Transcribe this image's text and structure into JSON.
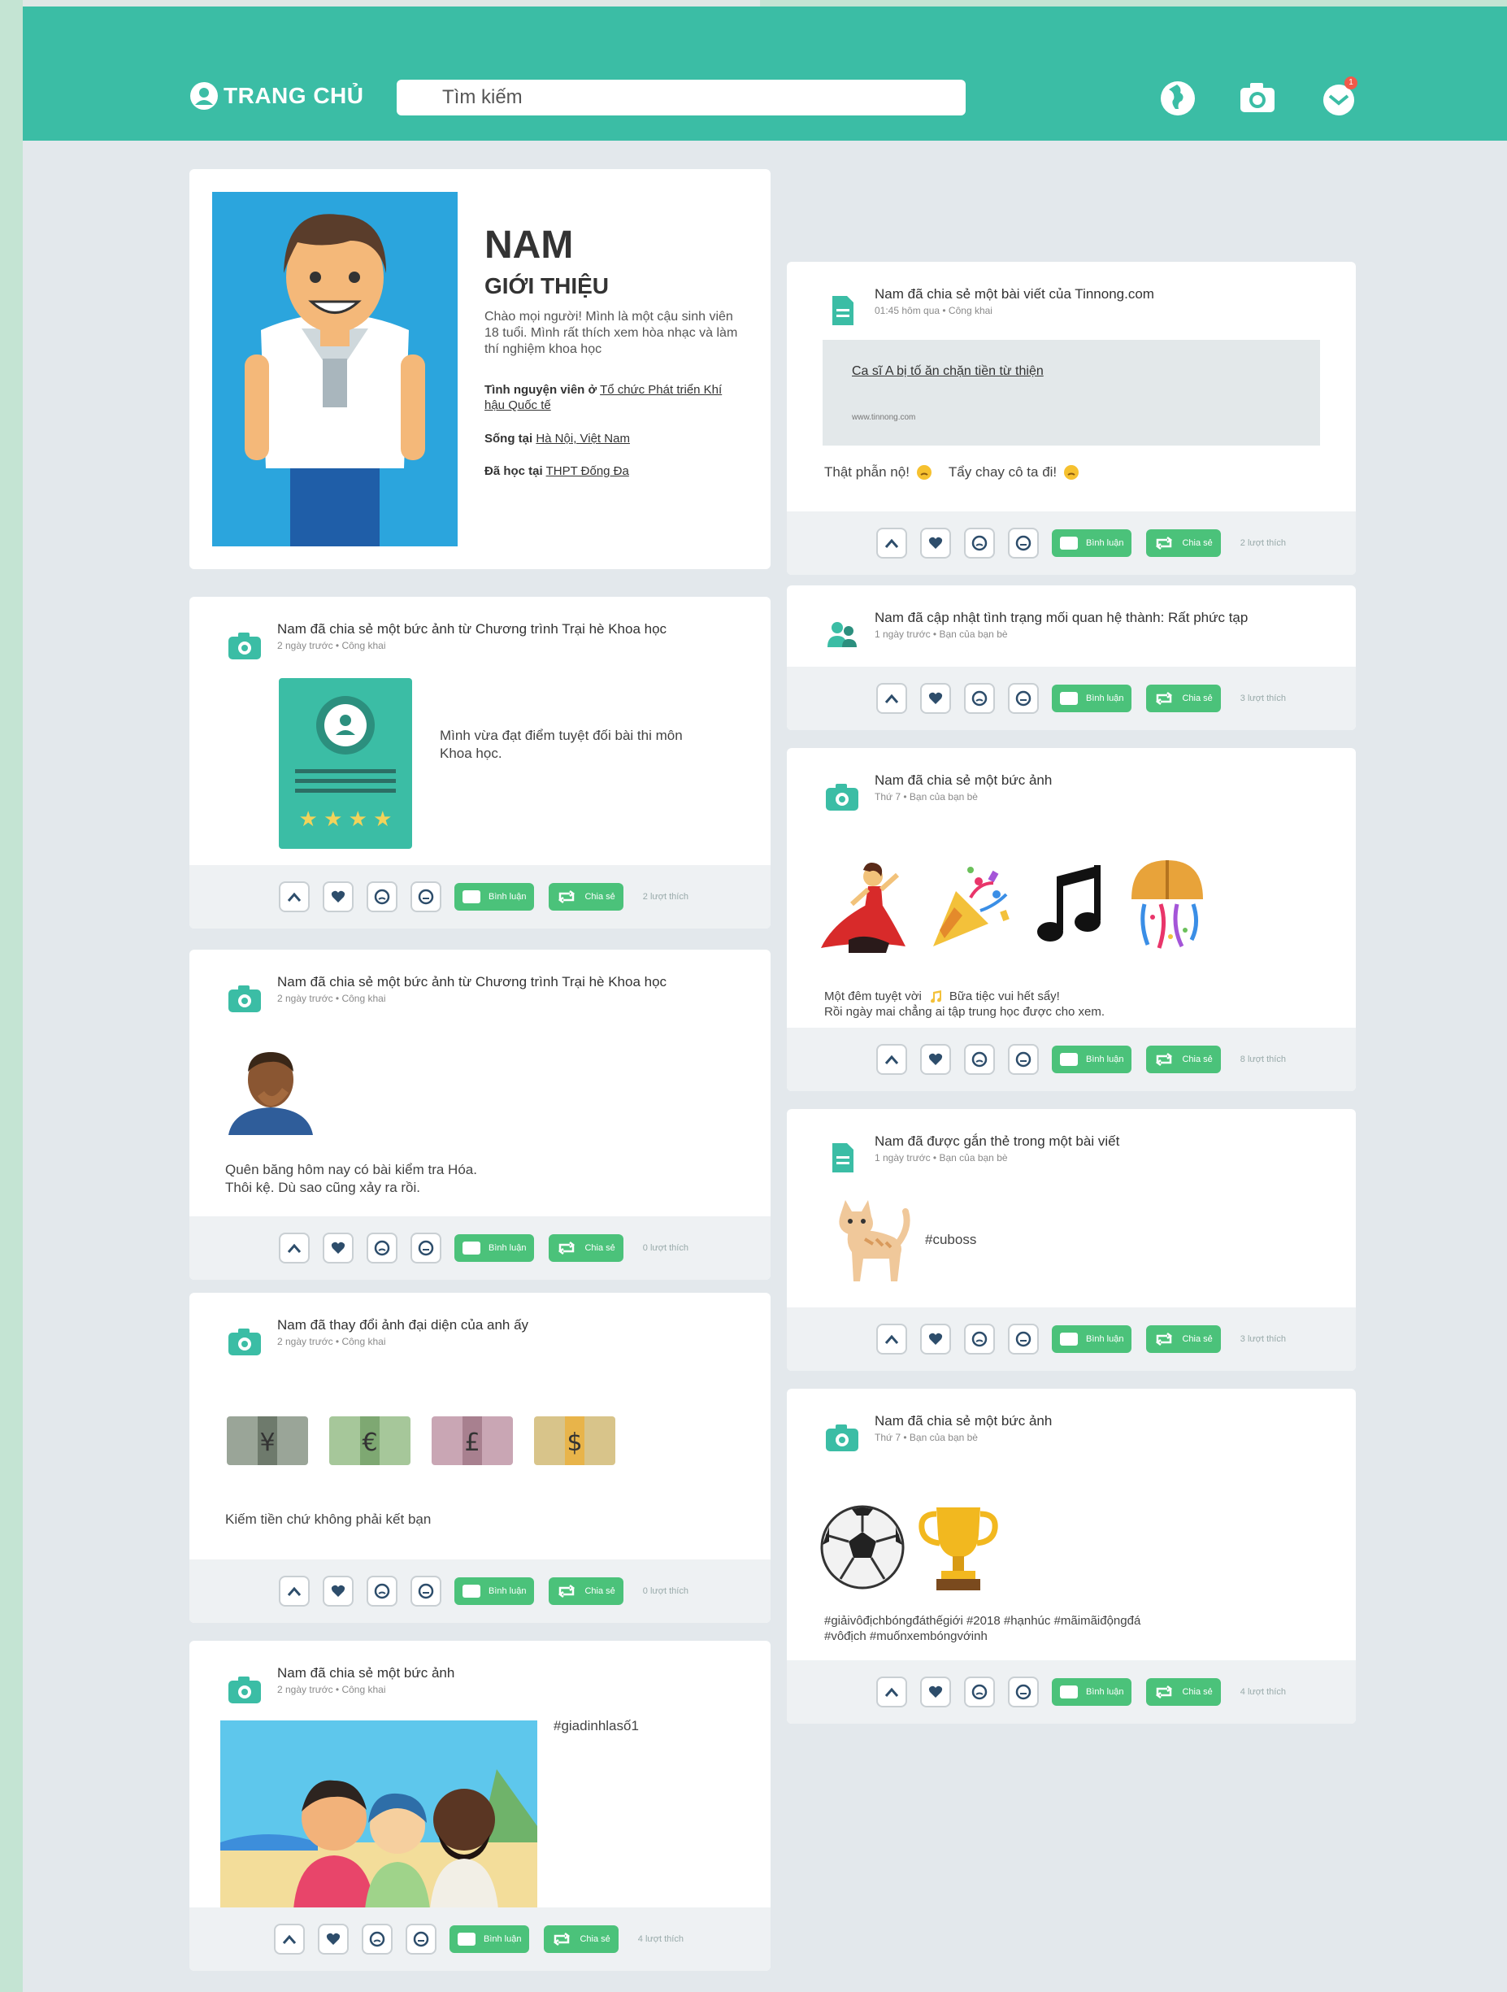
{
  "nav": {
    "home_label": "TRANG CHỦ",
    "search_placeholder": "Tìm kiếm",
    "notif_count": "1"
  },
  "profile": {
    "name": "NAM",
    "intro_heading": "GIỚI THIỆU",
    "bio": "Chào mọi người! Mình là một cậu sinh viên 18 tuổi. Mình rất thích xem hòa nhạc và làm thí nghiệm khoa học",
    "volunteer_label": "Tình nguyện viên ở",
    "volunteer_org": "Tổ chức Phát triển Khí hậu Quốc tế",
    "lives_label": "Sống tại",
    "lives_place": "Hà Nội, Việt Nam",
    "studied_label": "Đã học tại",
    "studied_place": "THPT Đống Đa"
  },
  "actions": {
    "comment_label": "Bình luận",
    "share_label": "Chia sẻ"
  },
  "left_posts": [
    {
      "title": "Nam đã chia sẻ một bức ảnh từ Chương trình Trại hè Khoa học",
      "meta": "2 ngày trước • Công khai",
      "text": "Mình vừa đạt điểm tuyệt đối bài thi môn Khoa học.",
      "count": "2 lượt thích"
    },
    {
      "title": "Nam đã chia sẻ một bức ảnh từ Chương trình Trại hè Khoa học",
      "meta": "2 ngày trước • Công khai",
      "text": "Quên băng hôm nay có bài kiểm tra Hóa. Thôi kệ. Dù sao cũng xảy ra rồi.",
      "count": "0 lượt thích"
    },
    {
      "title": "Nam đã thay đổi ảnh đại diện của anh ấy",
      "meta": "2 ngày trước • Công khai",
      "text": "Kiếm tiền chứ không phải kết bạn",
      "count": "0 lượt thích"
    },
    {
      "title": "Nam đã chia sẻ một bức ảnh",
      "meta": "2 ngày trước • Công khai",
      "text": "#giadinhlasố1",
      "count": "4 lượt thích"
    }
  ],
  "right_posts": [
    {
      "title": "Nam đã chia sẻ một bài viết của Tinnong.com",
      "meta": "01:45 hôm qua • Công khai",
      "link_title": "Ca sĩ A bị tố ăn chặn tiền từ thiện",
      "link_domain": "www.tinnong.com",
      "caption_a": "Thật phẫn nộ!",
      "caption_b": "Tẩy chay cô ta đi!",
      "count": "2 lượt thích"
    },
    {
      "title": "Nam đã cập nhật tình trạng mối quan hệ thành: Rất phức tạp",
      "meta": "1 ngày trước • Bạn của bạn bè",
      "count": "3 lượt thích"
    },
    {
      "title": "Nam đã chia sẻ một bức ảnh",
      "meta": "Thứ 7 • Bạn của bạn bè",
      "text_a": "Một đêm tuyệt vời",
      "text_b": "Bữa tiệc vui hết sẩy!",
      "text_c": "Rồi ngày mai chẳng ai tập trung học được cho xem.",
      "count": "8 lượt thích"
    },
    {
      "title": "Nam đã được gắn thẻ trong một bài viết",
      "meta": "1 ngày trước • Bạn của bạn bè",
      "text": "#cuboss",
      "count": "3 lượt thích"
    },
    {
      "title": "Nam đã chia sẻ một bức ảnh",
      "meta": "Thứ 7 • Bạn của bạn bè",
      "text_a": "#giảivôđịchbóngđáthếgiới #2018 #hạnhúc #mãimãiđộngđá",
      "text_b": "#vôđịch #muốnxembóngvớinh",
      "count": "4 lượt thích"
    }
  ],
  "colors": {
    "topbar": "#3bbda5",
    "accent": "#3bbda5",
    "green_button": "#4bc27a",
    "profile_bg": "#2ba5dd"
  }
}
